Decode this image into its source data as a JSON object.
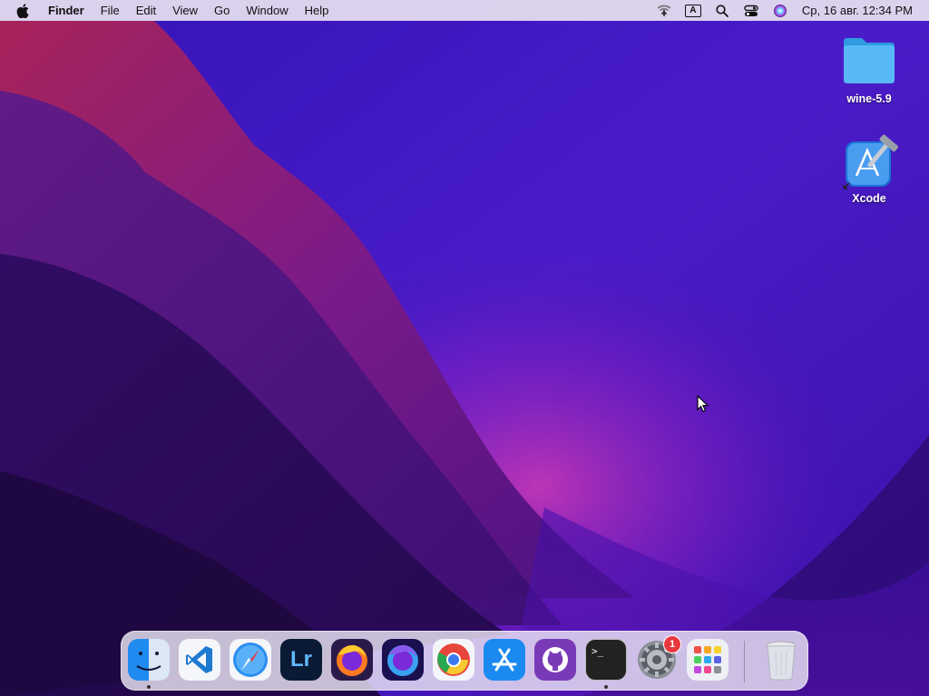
{
  "menubar": {
    "app_name": "Finder",
    "menus": [
      "File",
      "Edit",
      "View",
      "Go",
      "Window",
      "Help"
    ],
    "input_indicator": "A",
    "clock": "Ср, 16 авг.  12:34 PM",
    "status_icons": [
      "wifi-off-icon",
      "input-source-icon",
      "spotlight-search-icon",
      "control-center-icon",
      "siri-icon"
    ]
  },
  "desktop": {
    "items": [
      {
        "label": "wine-5.9",
        "icon": "folder-icon"
      },
      {
        "label": "Xcode",
        "icon": "xcode-alias-icon"
      }
    ]
  },
  "dock": {
    "apps": [
      {
        "name": "Finder",
        "icon": "finder-icon",
        "running": true
      },
      {
        "name": "Visual Studio Code",
        "icon": "vscode-icon",
        "running": false
      },
      {
        "name": "Safari",
        "icon": "safari-icon",
        "running": false
      },
      {
        "name": "Lightroom",
        "icon": "lightroom-icon",
        "label": "Lr",
        "running": false
      },
      {
        "name": "Firefox",
        "icon": "firefox-icon",
        "running": false
      },
      {
        "name": "Firefox Developer Edition",
        "icon": "firefox-dev-icon",
        "running": false
      },
      {
        "name": "Google Chrome",
        "icon": "chrome-icon",
        "running": false
      },
      {
        "name": "App Store",
        "icon": "app-store-icon",
        "running": false
      },
      {
        "name": "GitHub Desktop",
        "icon": "github-icon",
        "running": false
      },
      {
        "name": "Terminal",
        "icon": "terminal-icon",
        "label": ">_",
        "running": true
      },
      {
        "name": "System Preferences",
        "icon": "system-preferences-icon",
        "running": false,
        "badge": "1"
      },
      {
        "name": "Launchpad",
        "icon": "launchpad-icon",
        "running": false
      },
      {
        "name": "Trash",
        "icon": "trash-icon",
        "running": false
      }
    ]
  },
  "colors": {
    "wallpaper_base": "#3a0fa0",
    "wallpaper_pink": "#c0268a",
    "badge": "#e8383d"
  }
}
